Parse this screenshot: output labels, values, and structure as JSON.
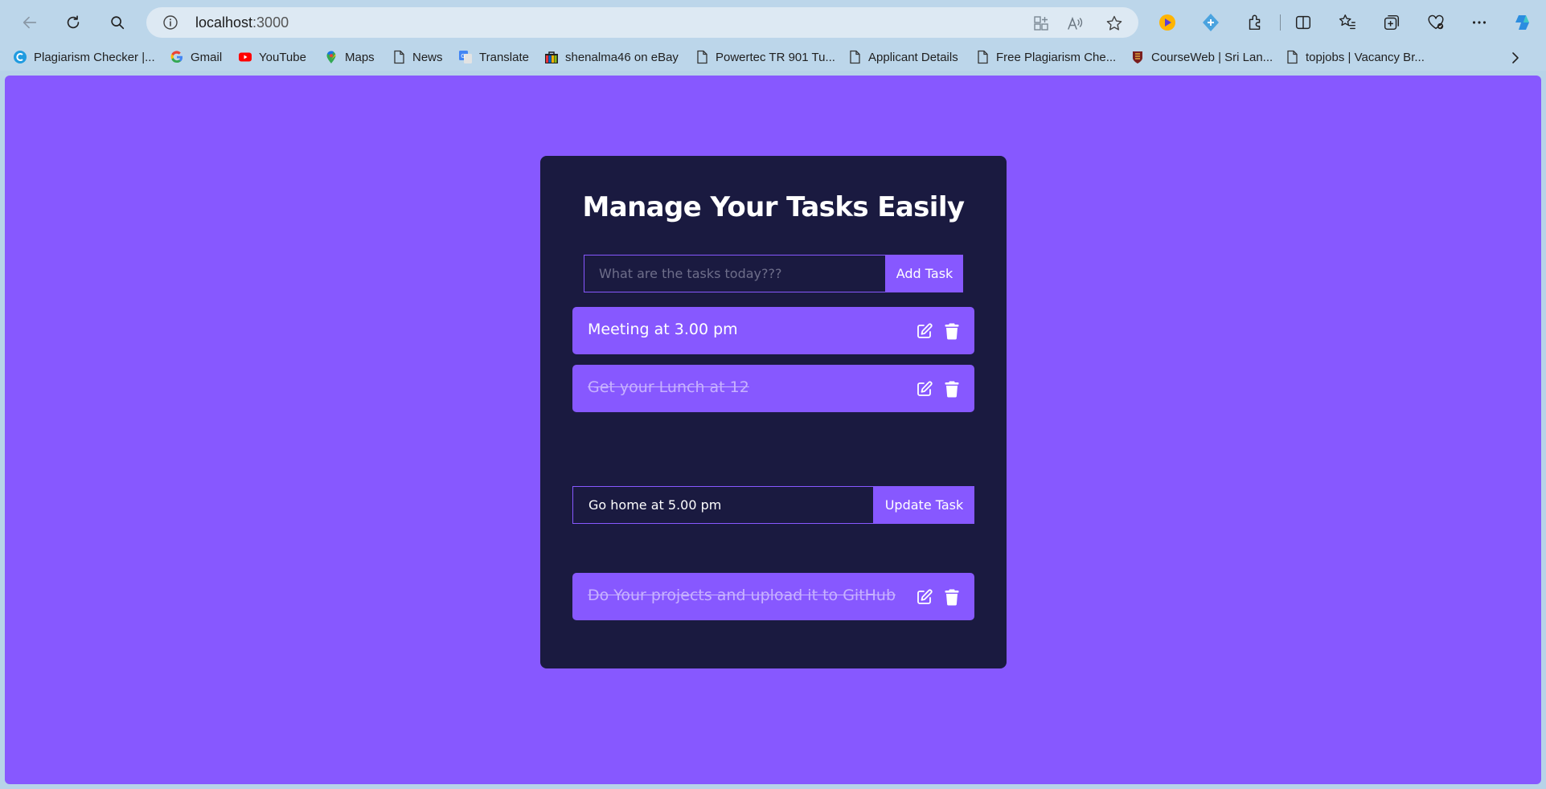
{
  "browser": {
    "url": "localhost",
    "url_port": ":3000",
    "bookmarks": [
      {
        "label": "Plagiarism Checker |..."
      },
      {
        "label": "Gmail"
      },
      {
        "label": "YouTube"
      },
      {
        "label": "Maps"
      },
      {
        "label": "News"
      },
      {
        "label": "Translate"
      },
      {
        "label": "shenalma46 on eBay"
      },
      {
        "label": "Powertec TR 901 Tu..."
      },
      {
        "label": "Applicant Details"
      },
      {
        "label": "Free Plagiarism Che..."
      },
      {
        "label": "CourseWeb | Sri Lan..."
      },
      {
        "label": "topjobs | Vacancy Br..."
      }
    ]
  },
  "app": {
    "title": "Manage Your Tasks Easily",
    "add_placeholder": "What are the tasks today???",
    "add_button": "Add Task",
    "update_button": "Update Task",
    "editing_value": "Go home at 5.00 pm",
    "todos": [
      {
        "text": "Meeting at 3.00 pm",
        "completed": false
      },
      {
        "text": "Get your Lunch at 12",
        "completed": true
      },
      {
        "text": "Do Your projects and upload it to GitHub",
        "completed": true
      }
    ]
  },
  "colors": {
    "accent": "#8758ff",
    "card": "#1a1a40",
    "chrome": "#bcd6ea"
  }
}
